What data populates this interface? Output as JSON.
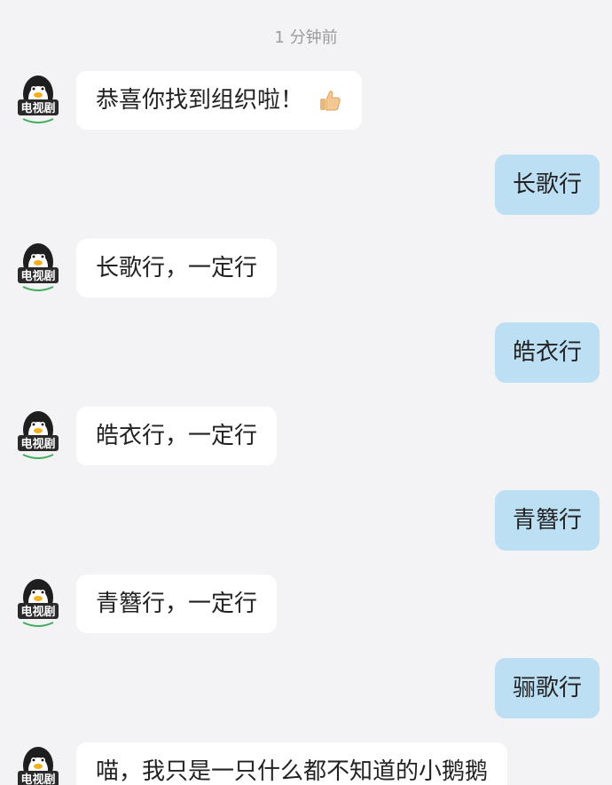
{
  "timestamp": "1 分钟前",
  "messages": [
    {
      "side": "bot",
      "text": "恭喜你找到组织啦！",
      "emoji": "thumbs-up"
    },
    {
      "side": "user",
      "text": "长歌行"
    },
    {
      "side": "bot",
      "text": "长歌行，一定行"
    },
    {
      "side": "user",
      "text": "皓衣行"
    },
    {
      "side": "bot",
      "text": "皓衣行，一定行"
    },
    {
      "side": "user",
      "text": "青簪行"
    },
    {
      "side": "bot",
      "text": "青簪行，一定行"
    },
    {
      "side": "user",
      "text": "骊歌行"
    },
    {
      "side": "bot",
      "text": "喵，我只是一只什么都不知道的小鹅鹅"
    }
  ],
  "colors": {
    "background": "#f3f3f5",
    "bot_bubble": "#ffffff",
    "user_bubble": "#bcdff4"
  }
}
